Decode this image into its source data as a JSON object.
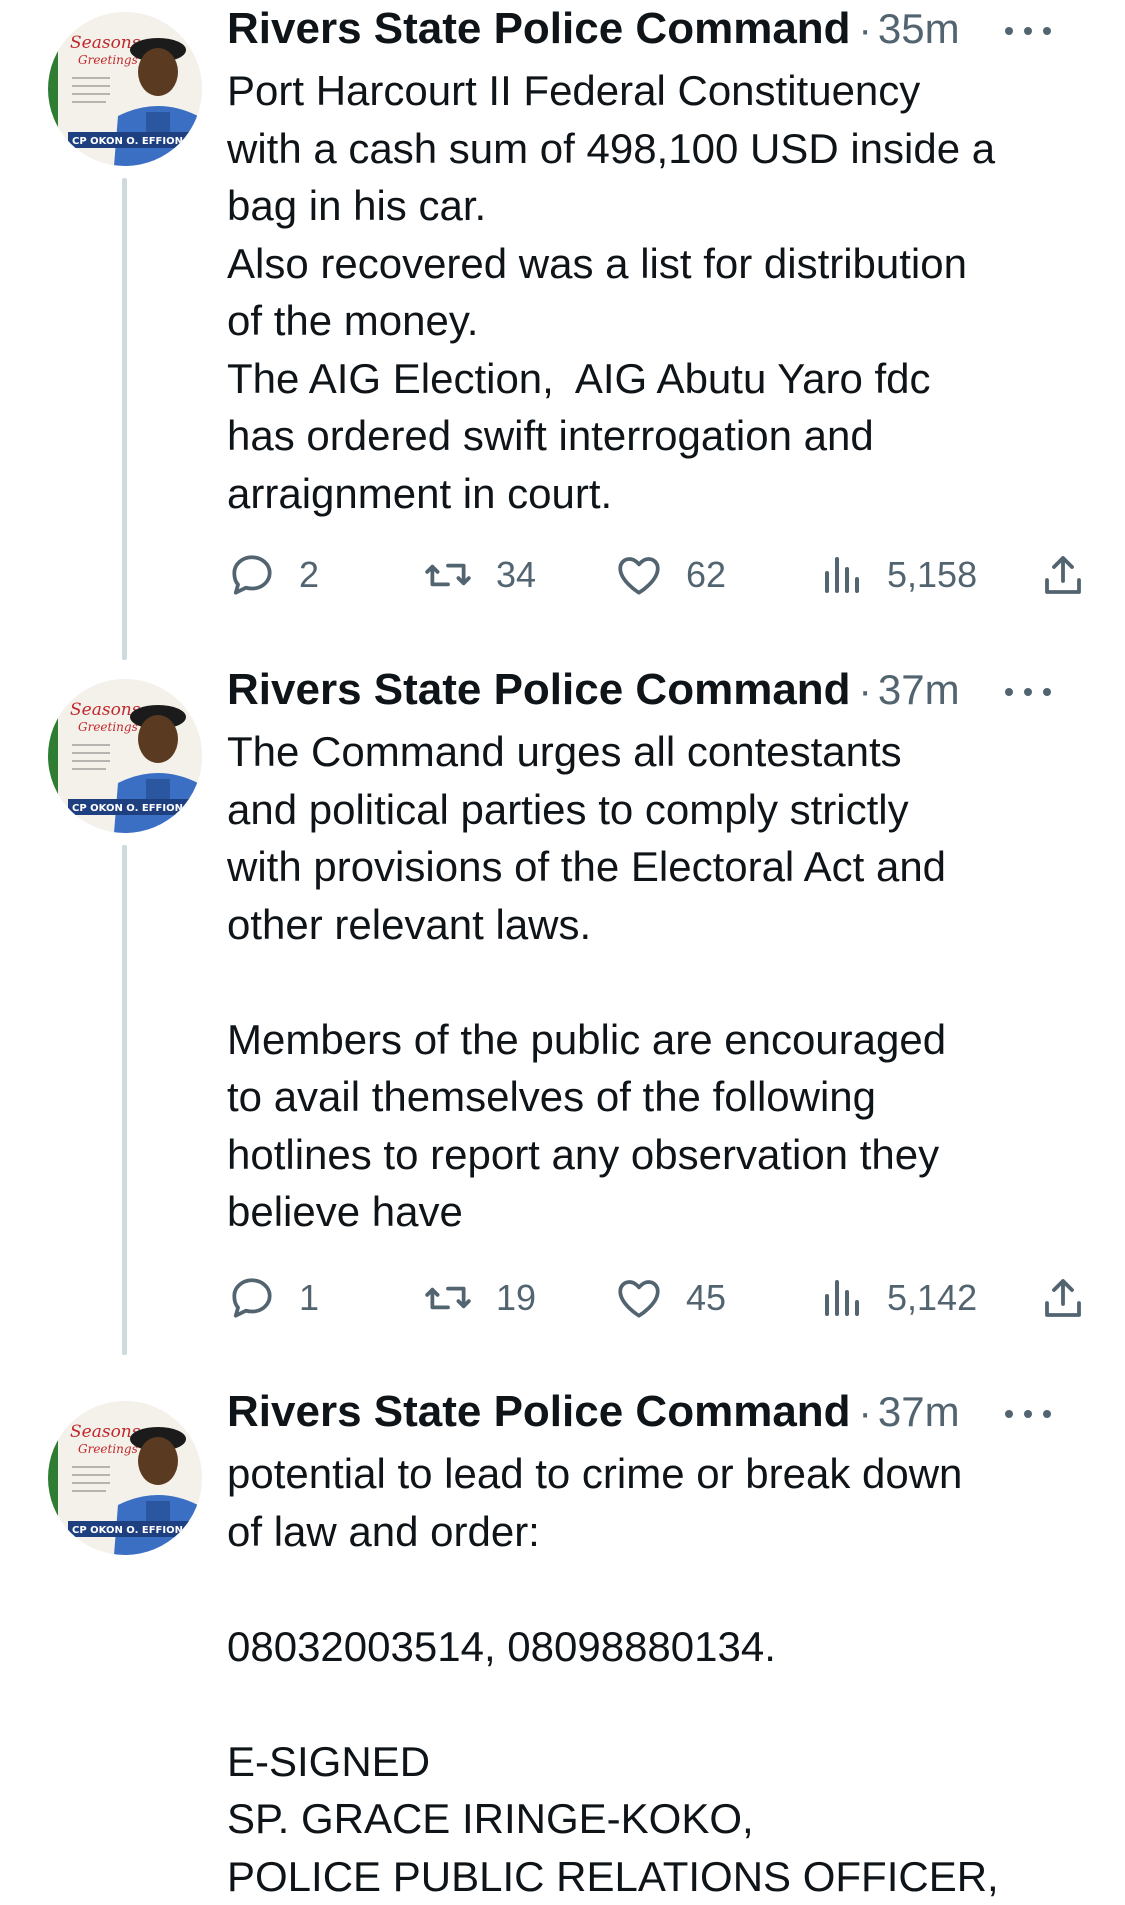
{
  "tweets": [
    {
      "author": "Rivers State Police Command",
      "separator": "·",
      "time": "35m",
      "lines": [
        "Port Harcourt II Federal Constituency",
        "with a cash sum of 498,100 USD inside a",
        "bag in his car.",
        "Also recovered was a list for distribution",
        "of the money.",
        "The AIG Election,  AIG Abutu Yaro fdc",
        "has ordered swift interrogation and",
        "arraignment in court."
      ],
      "replies": "2",
      "retweets": "34",
      "likes": "62",
      "views": "5,158"
    },
    {
      "author": "Rivers State Police Command",
      "separator": "·",
      "time": "37m",
      "lines": [
        "The Command urges all contestants",
        "and political parties to comply strictly",
        "with provisions of the Electoral Act and",
        "other relevant laws.",
        "",
        "Members of the public are encouraged",
        "to avail themselves of the following",
        "hotlines to report any observation they",
        "believe have"
      ],
      "replies": "1",
      "retweets": "19",
      "likes": "45",
      "views": "5,142"
    },
    {
      "author": "Rivers State Police Command",
      "separator": "·",
      "time": "37m",
      "lines": [
        "potential to lead to crime or break down",
        "of law and order:",
        "",
        "08032003514, 08098880134.",
        "",
        "E-SIGNED",
        "SP. GRACE IRINGE-KOKO,",
        "POLICE PUBLIC RELATIONS OFFICER,"
      ]
    }
  ],
  "avatar": {
    "greeting_line1": "Seasons",
    "greeting_line2": "Greetings",
    "name_band": "CP OKON O. EFFIONG"
  },
  "colors": {
    "text": "#0f1419",
    "secondary": "#536471",
    "thread_line": "#cfd9de",
    "uniform": "#3a6fc4",
    "greeting_red": "#c0282d"
  },
  "icons": [
    "reply-icon",
    "retweet-icon",
    "like-icon",
    "views-icon",
    "share-icon",
    "more-icon"
  ]
}
